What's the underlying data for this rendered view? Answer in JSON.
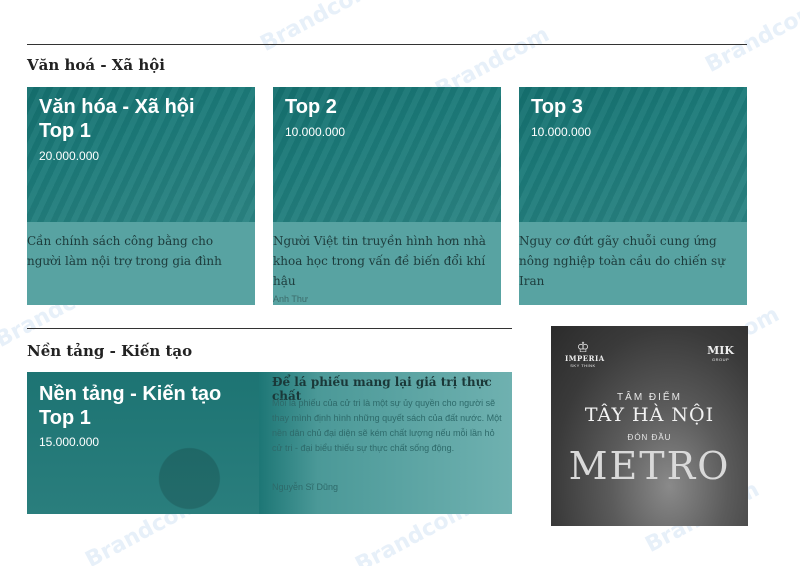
{
  "watermark": "Brandcom",
  "section1": {
    "title": "Văn hoá - Xã hội",
    "cards": [
      {
        "head_line1": "Văn hóa - Xã hội",
        "head_line2": "Top 1",
        "amount": "20.000.000",
        "headline": "Cần chính sách công bằng cho người làm nội trợ trong gia đình",
        "author": ""
      },
      {
        "head_line1": "Top 2",
        "head_line2": "",
        "amount": "10.000.000",
        "headline": "Người Việt tin truyền hình hơn nhà khoa học trong vấn đề biến đổi khí hậu",
        "author": "Anh Thư"
      },
      {
        "head_line1": "Top 3",
        "head_line2": "",
        "amount": "10.000.000",
        "headline": "Nguy cơ đứt gãy chuỗi cung ứng nông nghiệp toàn cầu do chiến sự Iran",
        "author": ""
      }
    ]
  },
  "section2": {
    "title": "Nền tảng - Kiến tạo",
    "card": {
      "head_line1": "Nền tảng - Kiến tạo",
      "head_line2": "Top 1",
      "amount": "15.000.000",
      "headline": "Để lá phiếu mang lại giá trị thực chất",
      "excerpt": "Mỗi lá phiếu của cử tri là một sự ủy quyền cho người sẽ thay mình định hình những quyết sách của đất nước. Một nền dân chủ đại diện sẽ kém chất lượng nếu mỗi lần hỏ cử tri - đại biểu thiếu sự thực chất sống động.",
      "author": "Nguyễn Sĩ Dũng"
    }
  },
  "ad": {
    "logo_left_name": "IMPERIA",
    "logo_left_sub": "SKY THINK",
    "logo_right_name": "MIK",
    "logo_right_sub": "GROUP",
    "line1": "TÂM ĐIỂM",
    "line2": "TÂY HÀ NỘI",
    "line3": "ĐÓN ĐẦU",
    "line4": "METRO"
  }
}
